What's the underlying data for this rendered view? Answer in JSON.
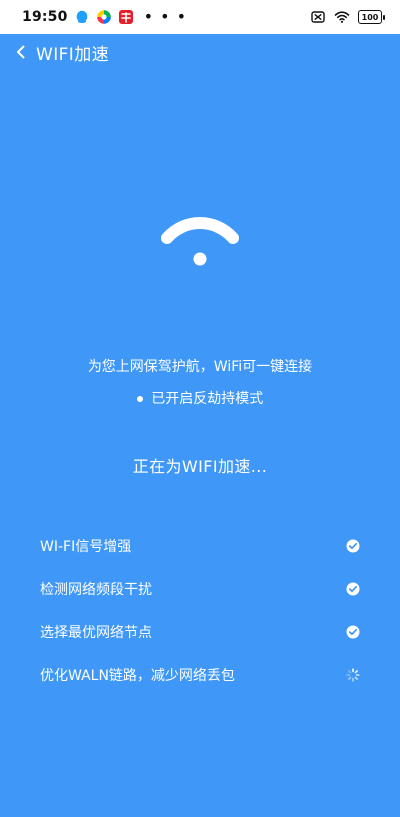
{
  "status_bar": {
    "time": "19:50",
    "dots": "• • •",
    "battery": "100"
  },
  "header": {
    "title": "WIFI加速"
  },
  "description": {
    "line1": "为您上网保驾护航，WiFi可一键连接",
    "line2": "已开启反劫持模式"
  },
  "progress_title": "正在为WIFI加速...",
  "tasks": [
    {
      "label": "WI-FI信号增强",
      "status": "done"
    },
    {
      "label": "检测网络频段干扰",
      "status": "done"
    },
    {
      "label": "选择最优网络节点",
      "status": "done"
    },
    {
      "label": "优化WALN链路，减少网络丢包",
      "status": "loading"
    }
  ],
  "colors": {
    "background": "#3f98f7",
    "text": "#ffffff"
  },
  "icons": {
    "back": "chevron-left-icon",
    "wifi": "wifi-icon",
    "done": "check-circle-icon",
    "loading": "spinner-icon"
  }
}
